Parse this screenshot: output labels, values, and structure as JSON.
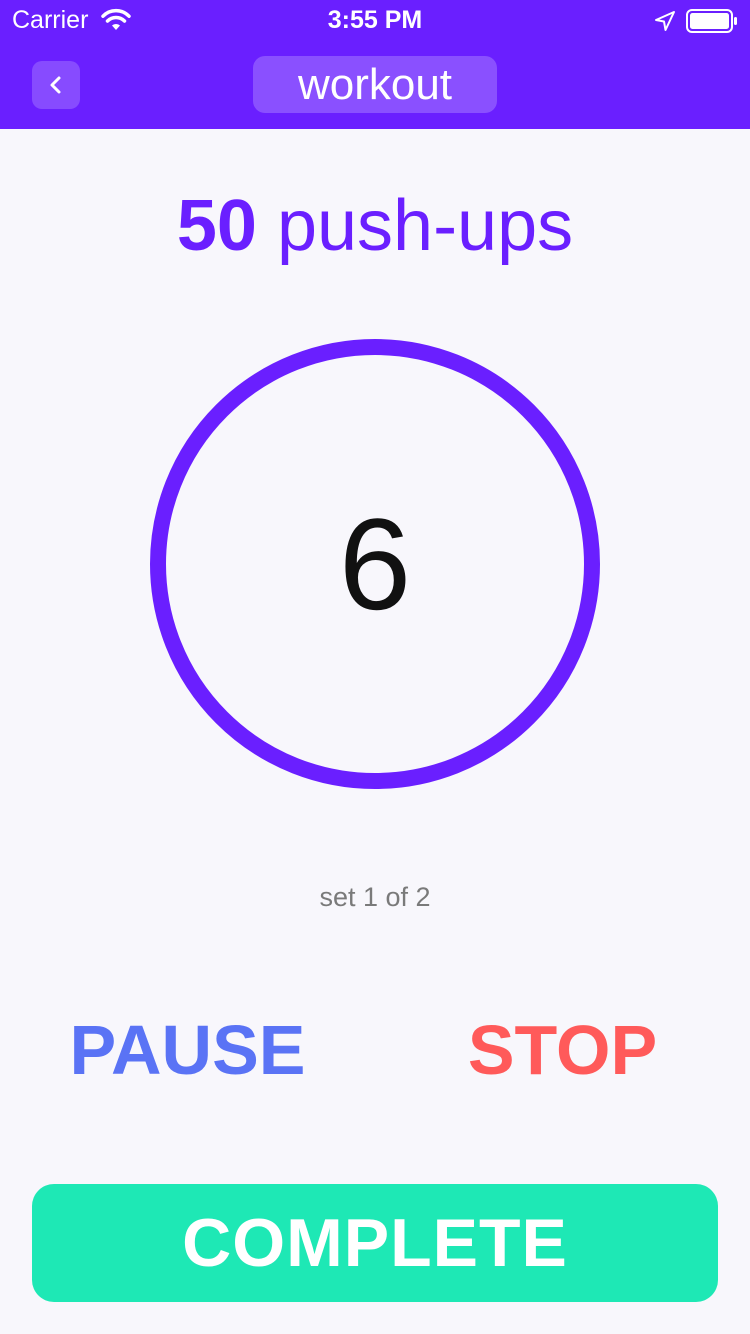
{
  "status_bar": {
    "carrier": "Carrier",
    "time": "3:55 PM",
    "icons": [
      "wifi-icon",
      "location-icon",
      "battery-icon"
    ]
  },
  "header": {
    "back_icon": "chevron-left-icon",
    "title": "workout"
  },
  "exercise": {
    "count": "50",
    "name": "push-ups"
  },
  "timer": {
    "value": "6"
  },
  "set_info": "set 1 of 2",
  "controls": {
    "pause_label": "PAUSE",
    "stop_label": "STOP",
    "complete_label": "COMPLETE"
  },
  "colors": {
    "accent": "#6a1fff",
    "pause": "#5a73f5",
    "stop": "#ff5a5a",
    "complete": "#1ee8b5",
    "background": "#f8f7fc"
  }
}
